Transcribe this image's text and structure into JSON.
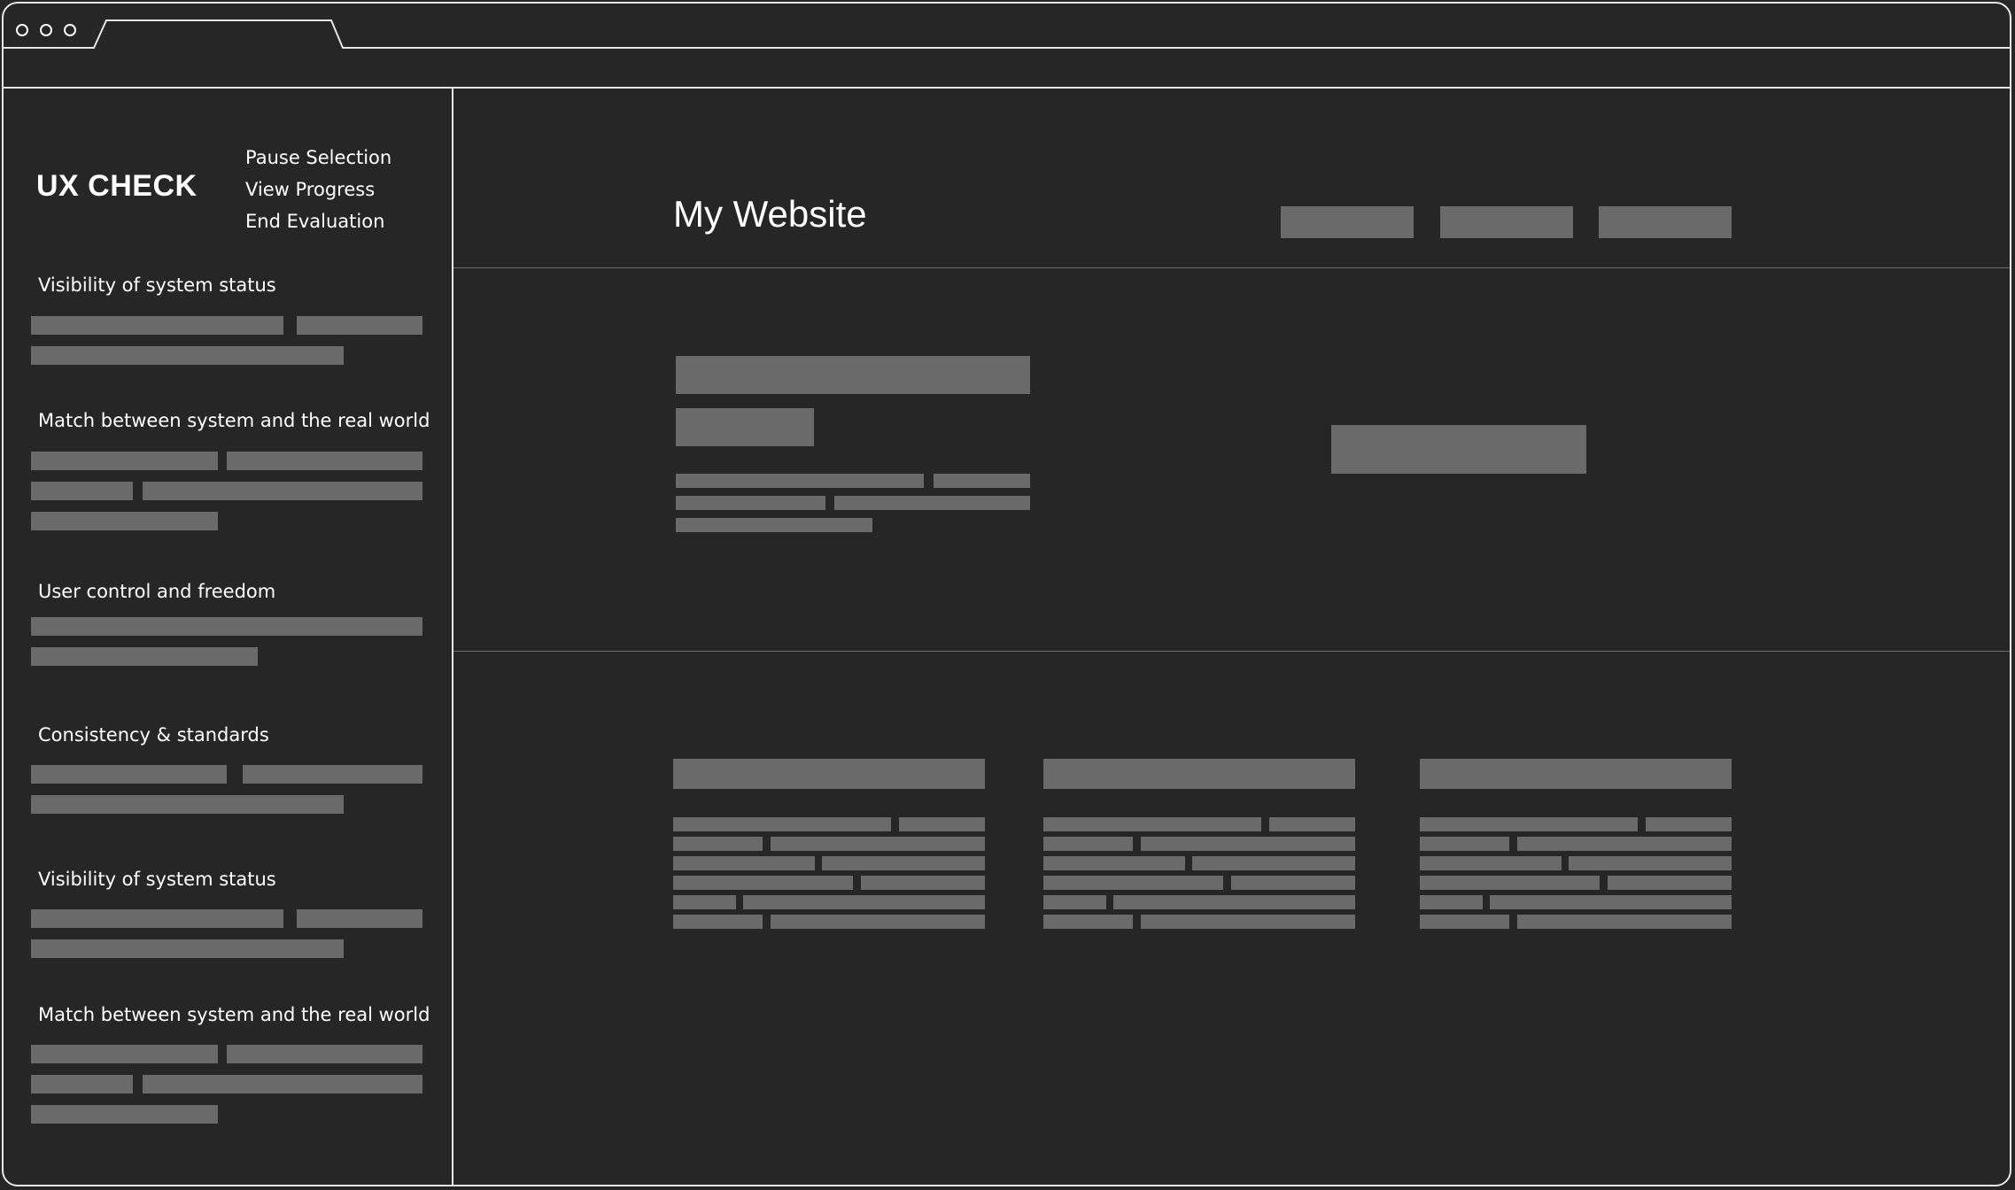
{
  "browser": {
    "tab_title": "",
    "address": ""
  },
  "sidebar": {
    "brand": "UX CHECK",
    "menu": [
      {
        "label": "Pause Selection"
      },
      {
        "label": "View Progress"
      },
      {
        "label": "End Evaluation"
      }
    ],
    "heuristics": [
      {
        "title": "Visibility of system status"
      },
      {
        "title": "Match between system and the real world"
      },
      {
        "title": "User control and freedom"
      },
      {
        "title": "Consistency & standards"
      },
      {
        "title": "Visibility of system status"
      },
      {
        "title": "Match between system and the real world"
      }
    ]
  },
  "website": {
    "title": "My Website"
  },
  "colors": {
    "background": "#262626",
    "outline": "#e6e6e6",
    "placeholder": "#6a6a6a",
    "text": "#ffffff"
  },
  "icons": {
    "window_controls": [
      "close-dot-icon",
      "minimize-dot-icon",
      "maximize-dot-icon"
    ]
  }
}
